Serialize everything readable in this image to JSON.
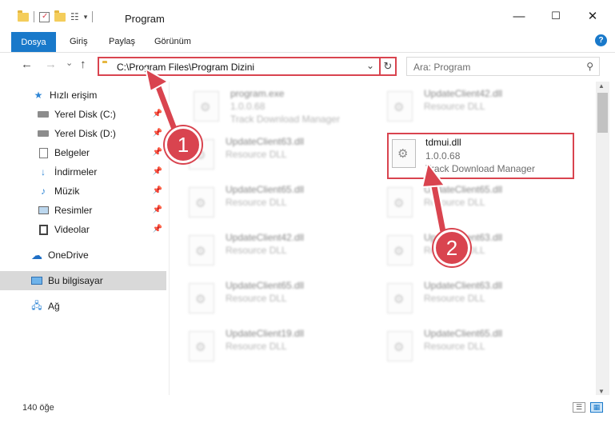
{
  "window": {
    "title": "Program",
    "controls": {
      "minimize": "—",
      "maximize": "☐",
      "close": "✕"
    }
  },
  "ribbon": {
    "tabs": [
      "Dosya",
      "Giriş",
      "Paylaş",
      "Görünüm"
    ],
    "help": "?"
  },
  "address": {
    "path": "C:\\Program Files\\Program Dizini",
    "dropdown": "⌄",
    "refresh": "↻"
  },
  "search": {
    "placeholder": "Ara: Program"
  },
  "nav": {
    "back": "←",
    "forward": "→",
    "recent": "⌄",
    "up": "↑",
    "items": [
      {
        "label": "Hızlı erişim",
        "icon": "star-icon",
        "pinned": false
      },
      {
        "label": "Yerel Disk (C:)",
        "icon": "drive-icon",
        "pinned": true
      },
      {
        "label": "Yerel Disk (D:)",
        "icon": "drive-icon",
        "pinned": true
      },
      {
        "label": "Belgeler",
        "icon": "documents-icon",
        "pinned": true
      },
      {
        "label": "İndirmeler",
        "icon": "download-icon",
        "pinned": true
      },
      {
        "label": "Müzik",
        "icon": "music-icon",
        "pinned": true
      },
      {
        "label": "Resimler",
        "icon": "pictures-icon",
        "pinned": true
      },
      {
        "label": "Videolar",
        "icon": "video-icon",
        "pinned": true
      },
      {
        "label": "OneDrive",
        "icon": "cloud-icon",
        "pinned": false
      },
      {
        "label": "Bu bilgisayar",
        "icon": "computer-icon",
        "pinned": false
      },
      {
        "label": "Ağ",
        "icon": "network-icon",
        "pinned": false
      }
    ]
  },
  "files": [
    {
      "name": "program.exe",
      "line2": "1.0.0.68",
      "line3": "Track Download Manager"
    },
    {
      "name": "UpdateClient42.dll",
      "line2": "Resource DLL",
      "line3": ""
    },
    {
      "name": "UpdateClient63.dll",
      "line2": "Resource DLL",
      "line3": ""
    },
    {
      "name": "UpdateClient65.dll",
      "line2": "Resource DLL",
      "line3": ""
    },
    {
      "name": "UpdateClient65.dll",
      "line2": "Resource DLL",
      "line3": ""
    },
    {
      "name": "UpdateClient42.dll",
      "line2": "Resource DLL",
      "line3": ""
    },
    {
      "name": "UpdateClient63.dll",
      "line2": "Resource DLL",
      "line3": ""
    },
    {
      "name": "UpdateClient65.dll",
      "line2": "Resource DLL",
      "line3": ""
    },
    {
      "name": "UpdateClient63.dll",
      "line2": "Resource DLL",
      "line3": ""
    },
    {
      "name": "UpdateClient19.dll",
      "line2": "Resource DLL",
      "line3": ""
    },
    {
      "name": "UpdateClient65.dll",
      "line2": "Resource DLL",
      "line3": ""
    }
  ],
  "highlighted_file": {
    "name": "tdmui.dll",
    "line2": "1.0.0.68",
    "line3": "Track Download Manager"
  },
  "callouts": [
    "1",
    "2"
  ],
  "status": {
    "count": "140 öğe"
  },
  "colors": {
    "accent": "#1979ca",
    "highlight": "#d9444f"
  }
}
